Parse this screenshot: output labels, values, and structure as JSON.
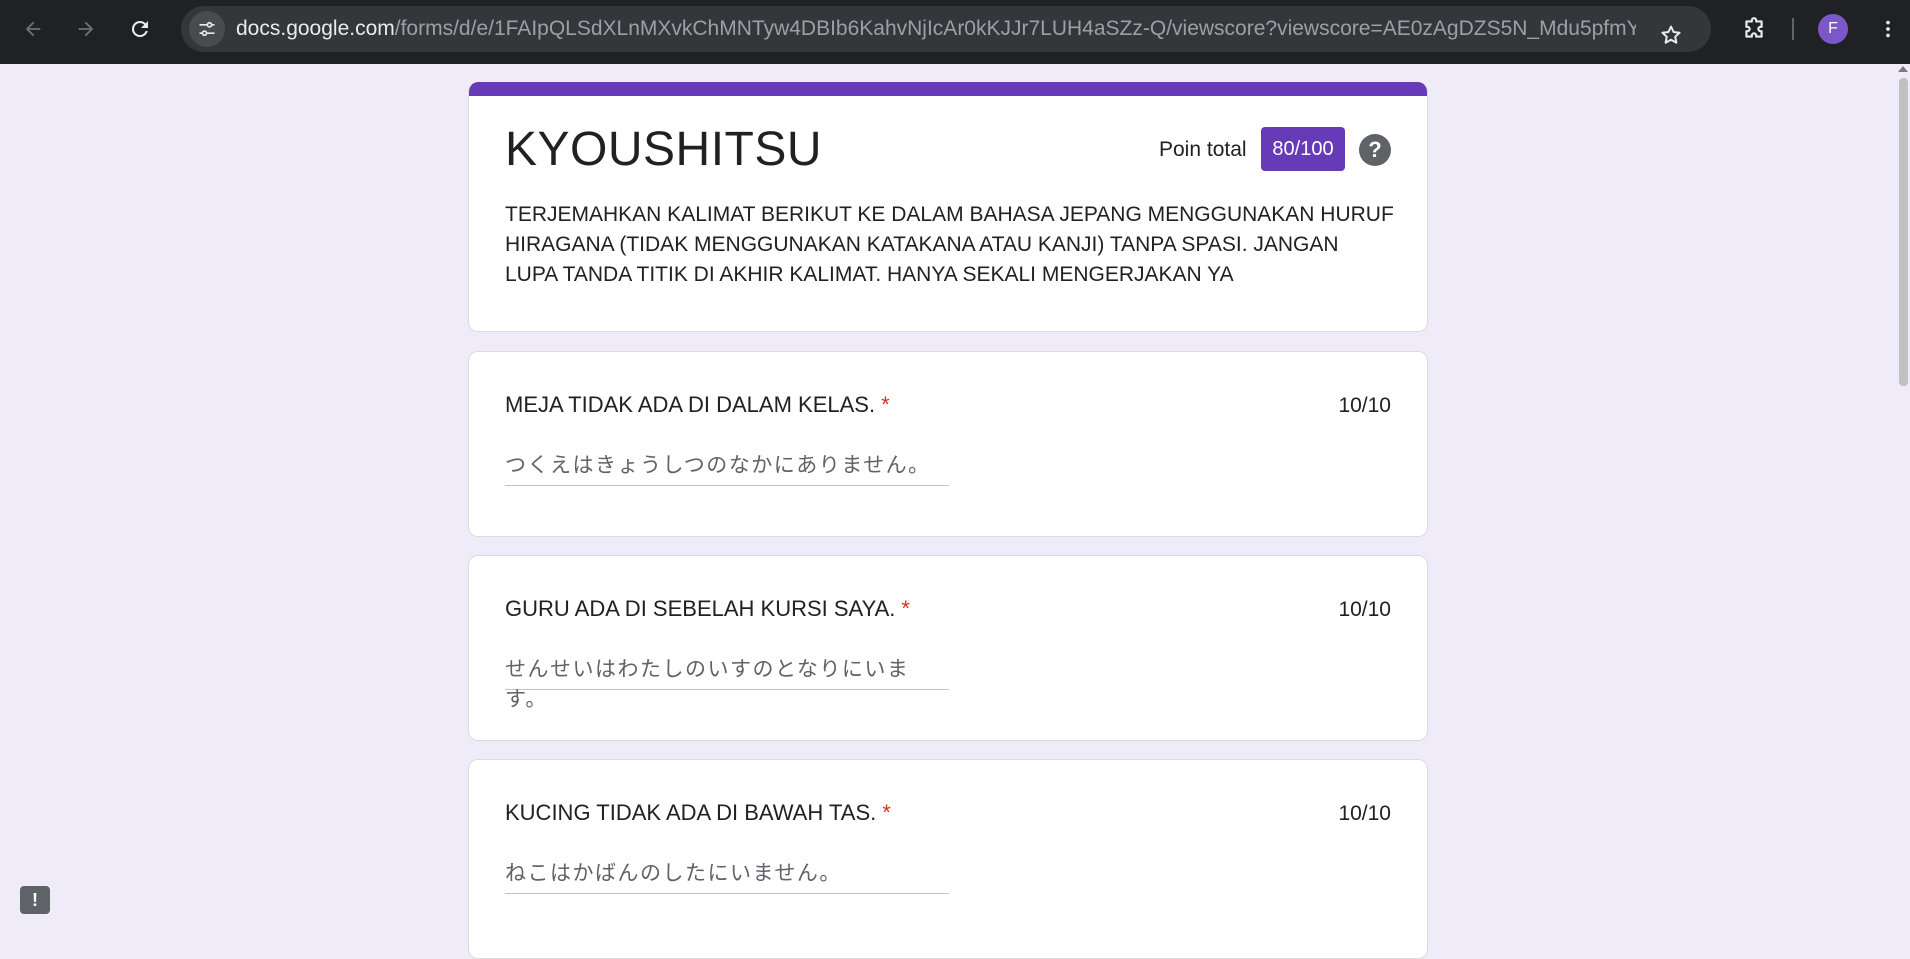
{
  "browser": {
    "url_host": "docs.google.com",
    "url_path": "/forms/d/e/1FAIpQLSdXLnMXvkChMNTyw4DBIb6KahvNjIcAr0kKJJr7LUH4aSZz-Q/viewscore?viewscore=AE0zAgDZS5N_Mdu5pfmYoE...",
    "profile_initial": "F",
    "icons": {
      "back": "arrow-left-icon",
      "forward": "arrow-right-icon",
      "reload": "reload-icon",
      "site_info": "tune-icon",
      "bookmark": "star-icon",
      "extensions": "puzzle-icon",
      "menu": "kebab-menu-icon"
    }
  },
  "form": {
    "title": "KYOUSHITSU",
    "points_label": "Poin total",
    "points_value": "80/100",
    "description": "TERJEMAHKAN KALIMAT BERIKUT KE DALAM BAHASA JEPANG MENGGUNAKAN HURUF HIRAGANA (TIDAK MENGGUNAKAN KATAKANA ATAU KANJI) TANPA SPASI. JANGAN LUPA TANDA TITIK DI AKHIR KALIMAT. HANYA SEKALI MENGERJAKAN YA",
    "accent_color": "#673ab7",
    "questions": [
      {
        "title": "MEJA TIDAK ADA DI DALAM KELAS.",
        "required_mark": "*",
        "score": "10/10",
        "answer": "つくえはきょうしつのなかにありません。"
      },
      {
        "title": "GURU ADA DI SEBELAH KURSI SAYA.",
        "required_mark": "*",
        "score": "10/10",
        "answer": "せんせいはわたしのいすのとなりにいます。"
      },
      {
        "title": "KUCING TIDAK ADA DI BAWAH TAS.",
        "required_mark": "*",
        "score": "10/10",
        "answer": "ねこはかばんのしたにいません。"
      }
    ]
  },
  "feedback": {
    "icon": "feedback-icon",
    "glyph": "!"
  }
}
